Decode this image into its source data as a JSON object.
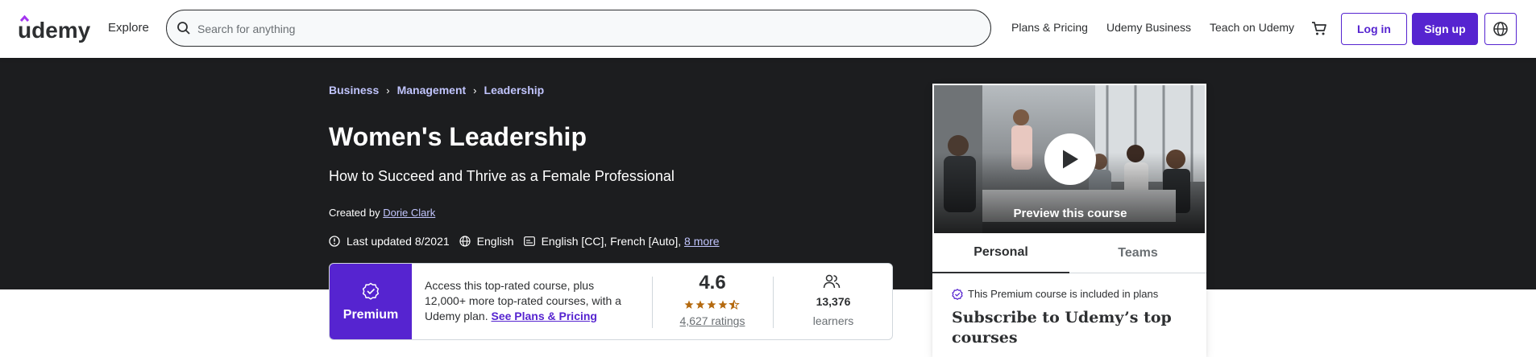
{
  "header": {
    "logo_text": "ûdemy",
    "explore": "Explore",
    "search_placeholder": "Search for anything",
    "nav": [
      "Plans & Pricing",
      "Udemy Business",
      "Teach on Udemy"
    ],
    "login": "Log in",
    "signup": "Sign up",
    "icons": [
      "search-icon",
      "cart-icon",
      "globe-icon"
    ]
  },
  "hero": {
    "breadcrumb": [
      "Business",
      "Management",
      "Leadership"
    ],
    "title": "Women's Leadership",
    "subtitle": "How to Succeed and Thrive as a Female Professional",
    "created_by_label": "Created by",
    "author": "Dorie Clark",
    "last_updated": "Last updated 8/2021",
    "language": "English",
    "captions": "English [CC], French [Auto],",
    "more_captions": "8 more"
  },
  "premium": {
    "badge": "Premium",
    "text": "Access this top-rated course, plus 12,000+ more top-rated courses, with a Udemy plan.",
    "link": "See Plans & Pricing",
    "rating": "4.6",
    "stars": 4.5,
    "ratings": "4,627 ratings",
    "learners_count": "13,376",
    "learners_label": "learners"
  },
  "sidebar": {
    "preview": "Preview this course",
    "tabs": [
      "Personal",
      "Teams"
    ],
    "included": "This Premium course is included in plans",
    "subscribe_title": "Subscribe to Udemy’s top courses"
  },
  "colors": {
    "brand": "#5624d0",
    "hero_bg": "#1c1d1f",
    "link_light": "#c0c4fc",
    "star": "#b4690e"
  }
}
